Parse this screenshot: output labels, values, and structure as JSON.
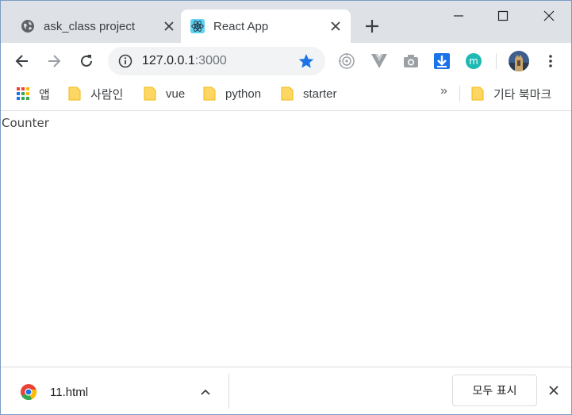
{
  "tabs": [
    {
      "title": "ask_class project",
      "icon": "globe-icon",
      "active": false
    },
    {
      "title": "React App",
      "icon": "react-logo-icon",
      "active": true
    }
  ],
  "window_controls": {
    "minimize": "minimize-icon",
    "maximize": "maximize-icon",
    "close": "close-icon"
  },
  "toolbar": {
    "url_host": "127.0.0.1",
    "url_port": ":3000",
    "bookmarked": true,
    "extensions": [
      "target-extension-icon",
      "vue-devtools-icon",
      "camera-extension-icon",
      "download-extension-icon",
      "m-extension-icon"
    ],
    "colors": {
      "star": "#1a73e8",
      "download_ext": "#1a73e8",
      "m_ext": "#1db9b3"
    }
  },
  "bookmarks": {
    "apps_label": "앱",
    "items": [
      {
        "label": "사람인"
      },
      {
        "label": "vue"
      },
      {
        "label": "python"
      },
      {
        "label": "starter"
      }
    ],
    "overflow": "»",
    "other_label": "기타 북마크"
  },
  "page": {
    "text": "Counter"
  },
  "downloads": {
    "file_name": "11.html",
    "show_all_label": "모두 표시"
  }
}
